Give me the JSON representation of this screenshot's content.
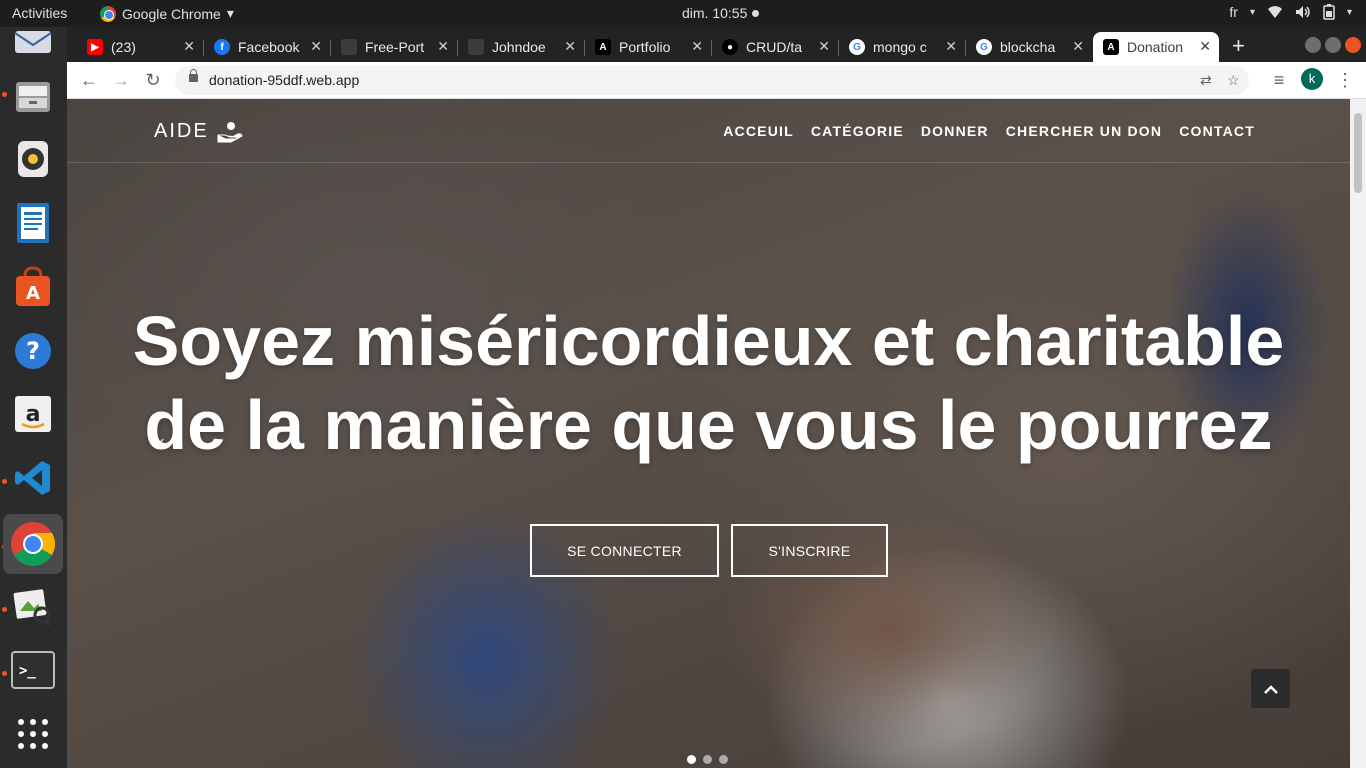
{
  "system": {
    "activities": "Activities",
    "app_name": "Google Chrome",
    "clock": "dim. 10:55",
    "keyboard_layout": "fr"
  },
  "dock": {
    "items": [
      "thunderbird-icon",
      "files-icon",
      "rhythmbox-icon",
      "writer-icon",
      "software-center-icon",
      "help-icon",
      "amazon-icon",
      "vscode-icon",
      "chrome-icon",
      "image-viewer-icon",
      "terminal-icon",
      "app-grid-icon"
    ]
  },
  "tabs": [
    {
      "title": "(23)",
      "icon": "youtube-icon",
      "color": "#ff0000"
    },
    {
      "title": "Facebook",
      "icon": "facebook-icon",
      "color": "#1877f2"
    },
    {
      "title": "Free-Port",
      "icon": "page-icon",
      "color": "#3c3c3c"
    },
    {
      "title": "Johndoe",
      "icon": "page-icon",
      "color": "#3c3c3c"
    },
    {
      "title": "Portfolio",
      "icon": "angular-icon",
      "color": "#000000"
    },
    {
      "title": "CRUD/ta",
      "icon": "github-icon",
      "color": "#000000"
    },
    {
      "title": "mongo c",
      "icon": "google-icon",
      "color": "#ffffff"
    },
    {
      "title": "blockcha",
      "icon": "google-icon",
      "color": "#ffffff"
    },
    {
      "title": "Donation",
      "icon": "angular-icon",
      "color": "#000000",
      "active": true
    }
  ],
  "toolbar": {
    "url": "donation-95ddf.web.app",
    "profile_initial": "k"
  },
  "page": {
    "brand": "AIDE",
    "nav": [
      "ACCEUIL",
      "CATÉGORIE",
      "DONNER",
      "CHERCHER UN DON",
      "CONTACT"
    ],
    "hero_line1": "Soyez miséricordieux et charitable",
    "hero_line2": "de la manière que vous le pourrez",
    "login_button": "SE CONNECTER",
    "signup_button": "S'INSCRIRE",
    "carousel_slides": 3,
    "carousel_active": 1
  }
}
